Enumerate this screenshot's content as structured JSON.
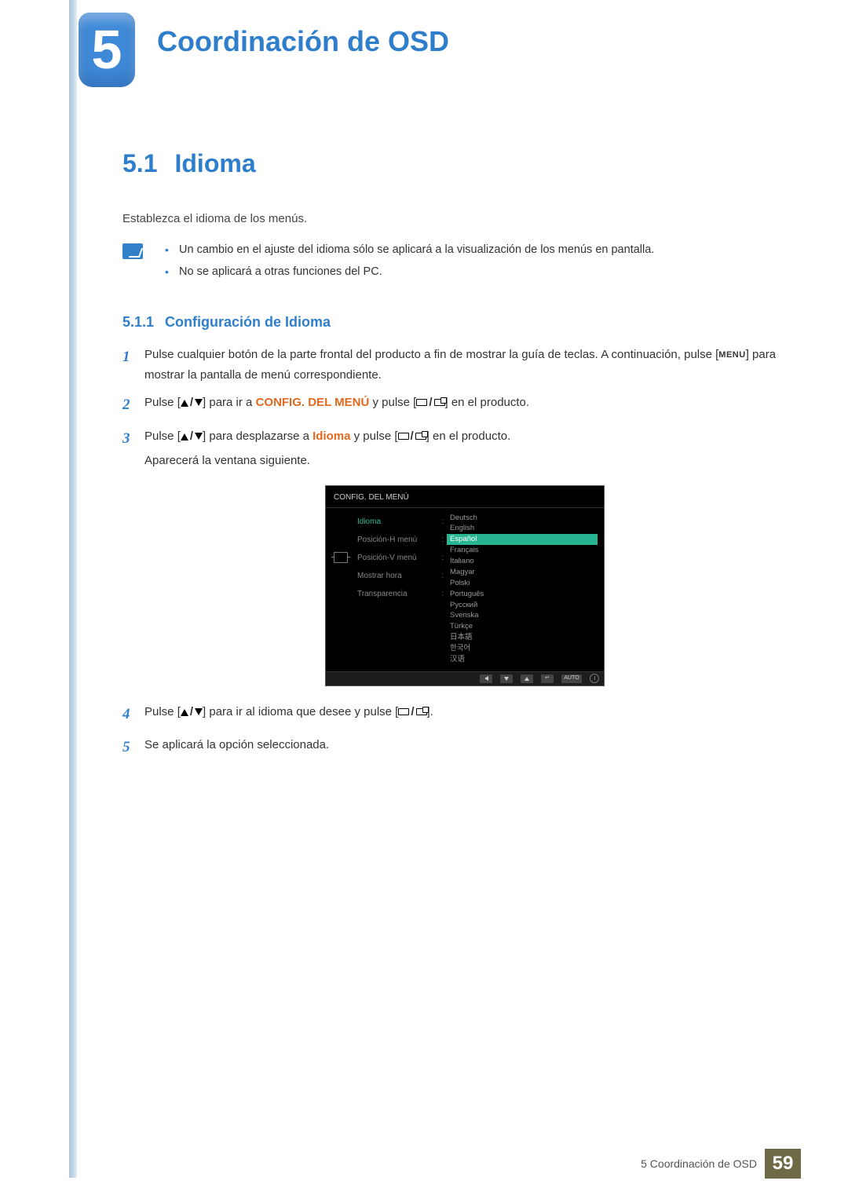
{
  "chapter": {
    "number": "5",
    "title": "Coordinación de OSD"
  },
  "section": {
    "number": "5.1",
    "title": "Idioma",
    "intro": "Establezca el idioma de los menús.",
    "notes": [
      "Un cambio en el ajuste del idioma sólo se aplicará a la visualización de los menús en pantalla.",
      "No se aplicará a otras funciones del PC."
    ]
  },
  "subsection": {
    "number": "5.1.1",
    "title": "Configuración de Idioma"
  },
  "steps": {
    "s1a": "Pulse cualquier botón de la parte frontal del producto a fin de mostrar la guía de teclas. A continuación, pulse [",
    "s1_menu": "MENU",
    "s1b": "] para mostrar la pantalla de menú correspondiente.",
    "s2a": "Pulse [",
    "s2b": "] para ir a ",
    "s2_hl": "CONFIG. DEL MENÚ",
    "s2c": " y pulse [",
    "s2d": "] en el producto.",
    "s3a": "Pulse [",
    "s3b": "] para desplazarse a ",
    "s3_hl": "Idioma",
    "s3c": " y pulse [",
    "s3d": "] en el producto.",
    "s3e": "Aparecerá la ventana siguiente.",
    "s4a": "Pulse [",
    "s4b": "] para ir al idioma que desee y pulse [",
    "s4c": "].",
    "s5": "Se aplicará la opción seleccionada."
  },
  "osd": {
    "title": "CONFIG. DEL MENÚ",
    "left": [
      {
        "label": "Idioma",
        "active": true
      },
      {
        "label": "Posición-H menú",
        "active": false
      },
      {
        "label": "Posición-V menú",
        "active": false
      },
      {
        "label": "Mostrar hora",
        "active": false
      },
      {
        "label": "Transparencia",
        "active": false
      }
    ],
    "languages": [
      "Deutsch",
      "English",
      "Español",
      "Français",
      "Italiano",
      "Magyar",
      "Polski",
      "Português",
      "Русский",
      "Svenska",
      "Türkçe",
      "日本語",
      "한국어",
      "汉语"
    ],
    "selected_language_index": 2,
    "auto_label": "AUTO"
  },
  "footer": {
    "text": "5 Coordinación de OSD",
    "page": "59"
  }
}
